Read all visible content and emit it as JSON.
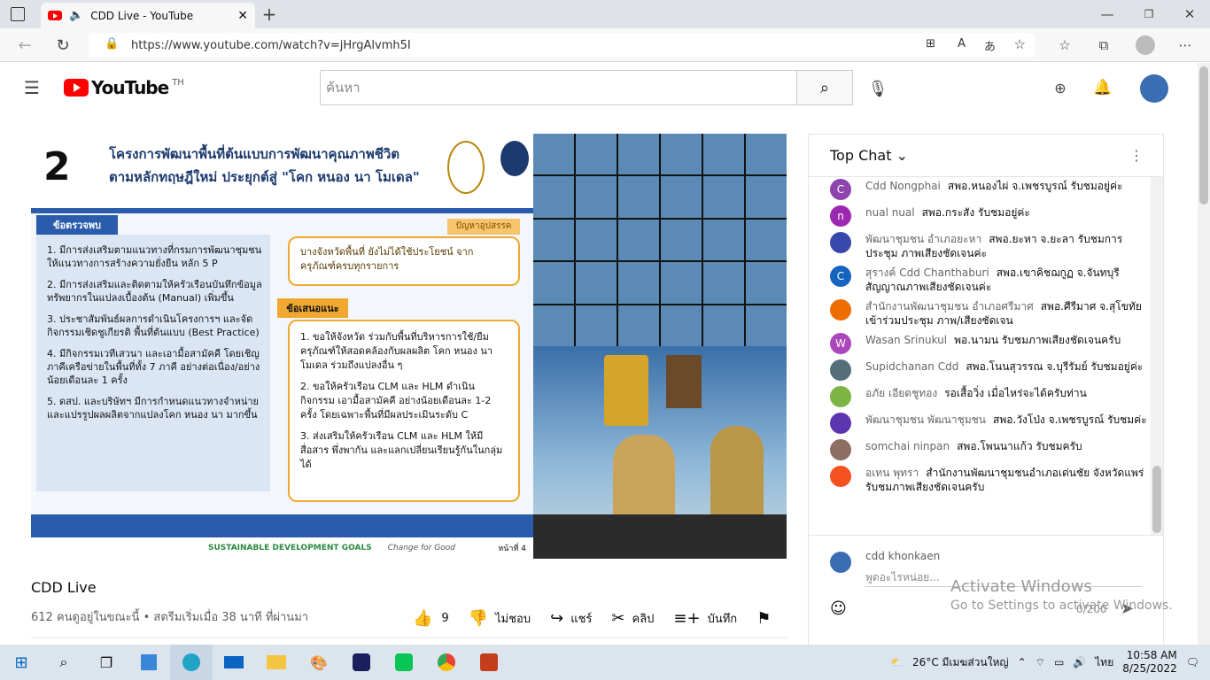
{
  "browser": {
    "tab_title": "CDD Live - YouTube",
    "url": "https://www.youtube.com/watch?v=jHrgAlvmh5I"
  },
  "youtube": {
    "logo": "YouTube",
    "region": "TH",
    "search_placeholder": "ค้นหา"
  },
  "video": {
    "slide_number": "2",
    "slide_title_1": "โครงการพัฒนาพื้นที่ต้นแบบการพัฒนาคุณภาพชีวิต",
    "slide_title_2": "ตามหลักทฤษฎีใหม่ ประยุกต์สู่ \"โคก หนอง นา โมเดล\"",
    "findings_label": "ข้อตรวจพบ",
    "findings": [
      "1. มีการส่งเสริมตามแนวทางที่กรมการพัฒนาชุมชน ให้แนวทางการสร้างความยั่งยืน หลัก 5 P",
      "2. มีการส่งเสริมและติดตามให้ครัวเรือนบันทึกข้อมูล ทรัพยากรในแปลงเบื้องต้น (Manual) เพิ่มขึ้น",
      "3. ประชาสัมพันธ์ผลการดำเนินโครงการฯ และจัดกิจกรรมเชิดชูเกียรติ พื้นที่ต้นแบบ (Best Practice)",
      "4. มีกิจกรรมเวทีเสวนา และเอามื้อสามัคคี โดยเชิญภาคีเครือข่ายในพื้นที่ทั้ง 7 ภาคี อย่างต่อเนื่อง/อย่างน้อยเดือนละ 1 ครั้ง",
      "5. ดสป. และบริษัทฯ มีการกำหนดแนวทางจำหน่าย และแปรรูปผลผลิตจากแปลงโคก หนอง นา มากขึ้น"
    ],
    "problems_label": "ปัญหาอุปสรรค",
    "problems": "บางจังหวัดพื้นที่ ยังไม่ได้ใช้ประโยชน์ จากครุภัณฑ์ครบทุกรายการ",
    "suggestions_label": "ข้อเสนอแนะ",
    "suggestions": [
      "1. ขอให้จังหวัด ร่วมกับพื้นที่บริหารการใช้/ยืม ครุภัณฑ์ให้สอดคล้องกับผลผลิต โคก หนอง นา โมเดล ร่วมถึงแปลงอื่น ๆ",
      "2. ขอให้ครัวเรือน CLM และ HLM ดำเนินกิจกรรม เอามื้อสามัคคี อย่างน้อยเดือนละ 1-2 ครั้ง โดยเฉพาะพื้นที่มีผลประเมินระดับ C",
      "3. ส่งเสริมให้ครัวเรือน CLM และ HLM ให้มีสื่อสาร พึ่งพากัน และแลกเปลี่ยนเรียนรู้กันในกลุ่มได้"
    ],
    "footer_goals": "SUSTAINABLE DEVELOPMENT GOALS",
    "footer_change": "Change for Good",
    "footer_page": "หน้าที่ 4",
    "title": "CDD Live",
    "meta": "612 คนดูอยู่ในขณะนี้ • สตรีมเริ่มเมื่อ 38 นาที ที่ผ่านมา",
    "like_count": "9",
    "dislike": "ไม่ชอบ",
    "share": "แชร์",
    "clip": "คลิป",
    "save": "บันทึก"
  },
  "chat": {
    "header": "Top Chat",
    "messages": [
      {
        "initial": "C",
        "color": "#8e44ad",
        "author": "Cdd Nongphai",
        "text": "สพอ.หนองไผ่ จ.เพชรบูรณ์ รับชมอยู่ค่ะ"
      },
      {
        "initial": "n",
        "color": "#9c27b0",
        "author": "nual nual",
        "text": "สพอ.กระสัง รับชมอยู่ค่ะ"
      },
      {
        "initial": "",
        "color": "#3949ab",
        "author": "พัฒนาชุมชน อำเภอยะหา",
        "text": "สพอ.ยะหา จ.ยะลา รับชมการประชุม ภาพเสียงชัดเจนค่ะ"
      },
      {
        "initial": "C",
        "color": "#1565c0",
        "author": "สุรางค์ Cdd Chanthaburi",
        "text": "สพอ.เขาคิชฌกูฏ จ.จันทบุรี สัญญาณภาพเสียงชัดเจนค่ะ"
      },
      {
        "initial": "",
        "color": "#ef6c00",
        "author": "สำนักงานพัฒนาชุมชน อำเภอศรีมาศ",
        "text": "สพอ.ศีรีมาศ จ.สุโขทัย เข้าร่วมประชุม ภาพ/เสียงชัดเจน"
      },
      {
        "initial": "W",
        "color": "#ab47bc",
        "author": "Wasan Srinukul",
        "text": "พอ.นามน รับชมภาพเสียงชัดเจนครับ"
      },
      {
        "initial": "",
        "color": "#546e7a",
        "author": "Supidchanan Cdd",
        "text": "สพอ.โนนสุวรรณ จ.บุรีรัมย์ รับชมอยู่ค่ะ"
      },
      {
        "initial": "",
        "color": "#7cb342",
        "author": "อภัย เอียดชูทอง",
        "text": "รอเสื้อวิ่ง เมื่อไหร่จะได้ครับท่าน"
      },
      {
        "initial": "",
        "color": "#5e35b1",
        "author": "พัฒนาชุมชน พัฒนาชุมชน",
        "text": "สพอ.วังโป่ง จ.เพชรบูรณ์ รับชมค่ะ"
      },
      {
        "initial": "",
        "color": "#8d6e63",
        "author": "somchai ninpan",
        "text": "สพอ.โพนนาแก้ว รับชมครับ"
      },
      {
        "initial": "",
        "color": "#f4511e",
        "author": "อเทน พุทรา",
        "text": "สำนักงานพัฒนาชุมชนอำเภอเด่นชัย จังหวัดแพร่ รับชมภาพเสียงชัดเจนครับ"
      }
    ],
    "input_user": "cdd khonkaen",
    "input_placeholder": "พูดอะไรหน่อย...",
    "counter": "0/200"
  },
  "watermark": {
    "line1": "Activate Windows",
    "line2": "Go to Settings to activate Windows."
  },
  "taskbar": {
    "weather": "26°C มีเมฆส่วนใหญ่",
    "lang": "ไทย",
    "time": "10:58 AM",
    "date": "8/25/2022"
  }
}
